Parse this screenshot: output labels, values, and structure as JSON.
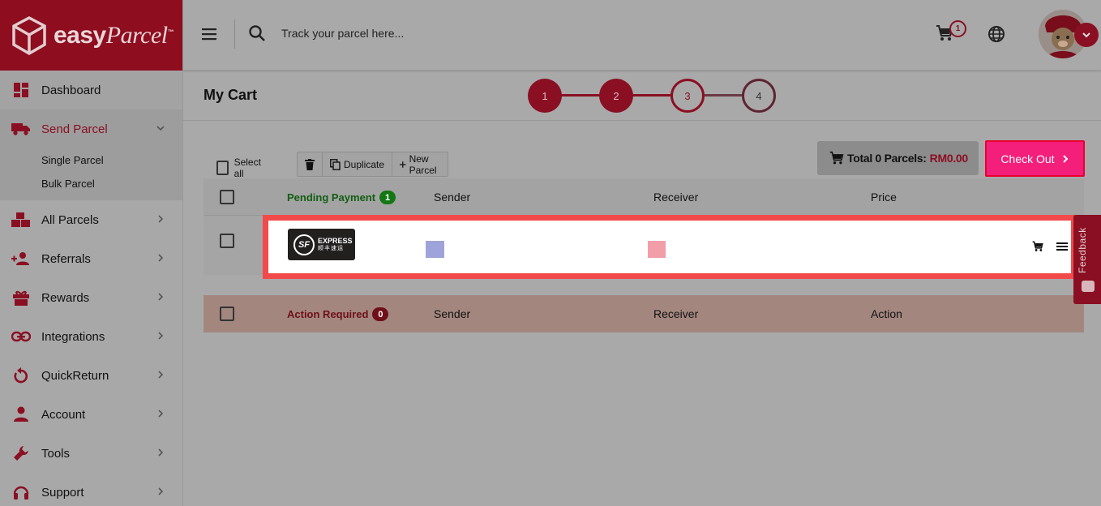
{
  "brand": {
    "name": "easy",
    "script": "Parcel",
    "tm": "™"
  },
  "topbar": {
    "search_placeholder": "Track your parcel here...",
    "cart_count": "1"
  },
  "sidebar": {
    "items": [
      {
        "label": "Dashboard"
      },
      {
        "label": "Send Parcel"
      },
      {
        "label": "All Parcels"
      },
      {
        "label": "Referrals"
      },
      {
        "label": "Rewards"
      },
      {
        "label": "Integrations"
      },
      {
        "label": "QuickReturn"
      },
      {
        "label": "Account"
      },
      {
        "label": "Tools"
      },
      {
        "label": "Support"
      }
    ],
    "subitems": [
      {
        "label": "Single Parcel"
      },
      {
        "label": "Bulk Parcel"
      }
    ]
  },
  "page": {
    "title": "My Cart"
  },
  "steps": [
    "1",
    "2",
    "3",
    "4"
  ],
  "toolbar": {
    "select_all": "Select all",
    "duplicate": "Duplicate",
    "new_parcel": "New Parcel"
  },
  "summary": {
    "total_label": "Total 0 Parcels:",
    "total_amount": "RM0.00",
    "checkout": "Check Out"
  },
  "pending": {
    "title": "Pending Payment",
    "count": "1",
    "sender": "Sender",
    "receiver": "Receiver",
    "price": "Price"
  },
  "action": {
    "title": "Action Required",
    "count": "0",
    "sender": "Sender",
    "receiver": "Receiver",
    "action": "Action"
  },
  "row": {
    "courier_logo_main": "EXPRESS",
    "courier_logo_cn": "顺丰速运",
    "courier_logo_mark": "SF"
  },
  "feedback": {
    "label": "Feedback"
  },
  "colors": {
    "brand": "#8a0f22",
    "checkout": "#f31f7b",
    "highlight": "#f2494b",
    "pending": "#137713"
  }
}
